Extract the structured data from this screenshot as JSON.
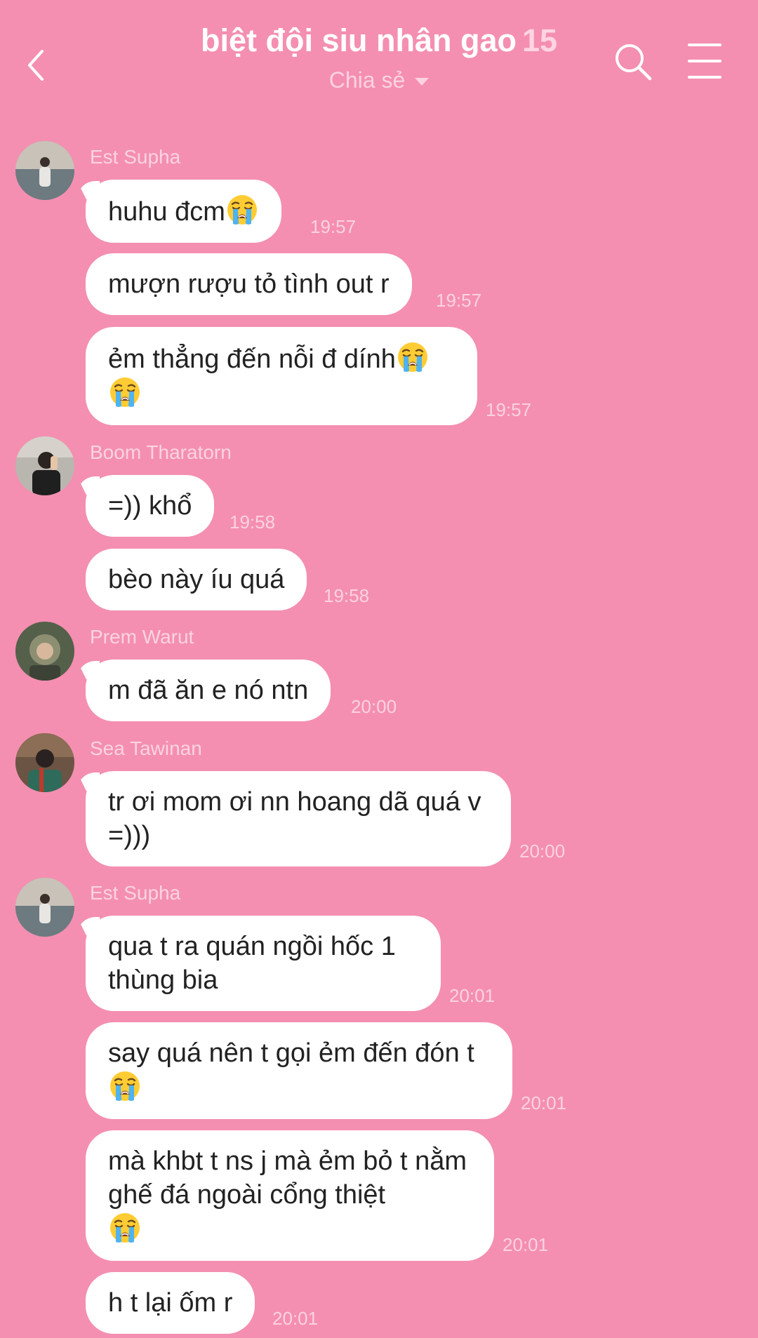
{
  "header": {
    "title": "biệt đội siu nhân gao",
    "member_count": "15",
    "subtitle": "Chia sẻ"
  },
  "colors": {
    "background": "#f48fb1",
    "bubble": "#ffffff",
    "meta_text": "#fcd2e2"
  },
  "messages": [
    {
      "sender": "Est Supha",
      "text": "huhu đcm",
      "emoji": "loudly-crying-face",
      "time": "19:57"
    },
    {
      "text": "mượn rượu tỏ tình out r",
      "time": "19:57"
    },
    {
      "text": "ẻm thẳng đến nỗi đ dính",
      "emoji": "loudly-crying-face",
      "time": "19:57"
    },
    {
      "sender": "Boom Tharatorn",
      "text": "=)) khổ",
      "time": "19:58"
    },
    {
      "text": "bèo này íu quá",
      "time": "19:58"
    },
    {
      "sender": "Prem Warut",
      "text": "m đã ăn e nó ntn",
      "time": "20:00"
    },
    {
      "sender": "Sea Tawinan",
      "text": "tr ơi mom ơi nn hoang dã quá v =)))",
      "time": "20:00"
    },
    {
      "sender": "Est Supha",
      "text": "qua t ra quán ngồi hốc 1 thùng bia",
      "time": "20:01"
    },
    {
      "text": "say quá nên t gọi ẻm đến đón t",
      "emoji": "loudly-crying-face",
      "time": "20:01"
    },
    {
      "text": "mà khbt t ns j mà ẻm bỏ t nằm ghế đá ngoài cổng thiệt",
      "emoji": "loudly-crying-face",
      "time": "20:01"
    },
    {
      "text": "h t lại ốm r",
      "time": "20:01"
    }
  ]
}
